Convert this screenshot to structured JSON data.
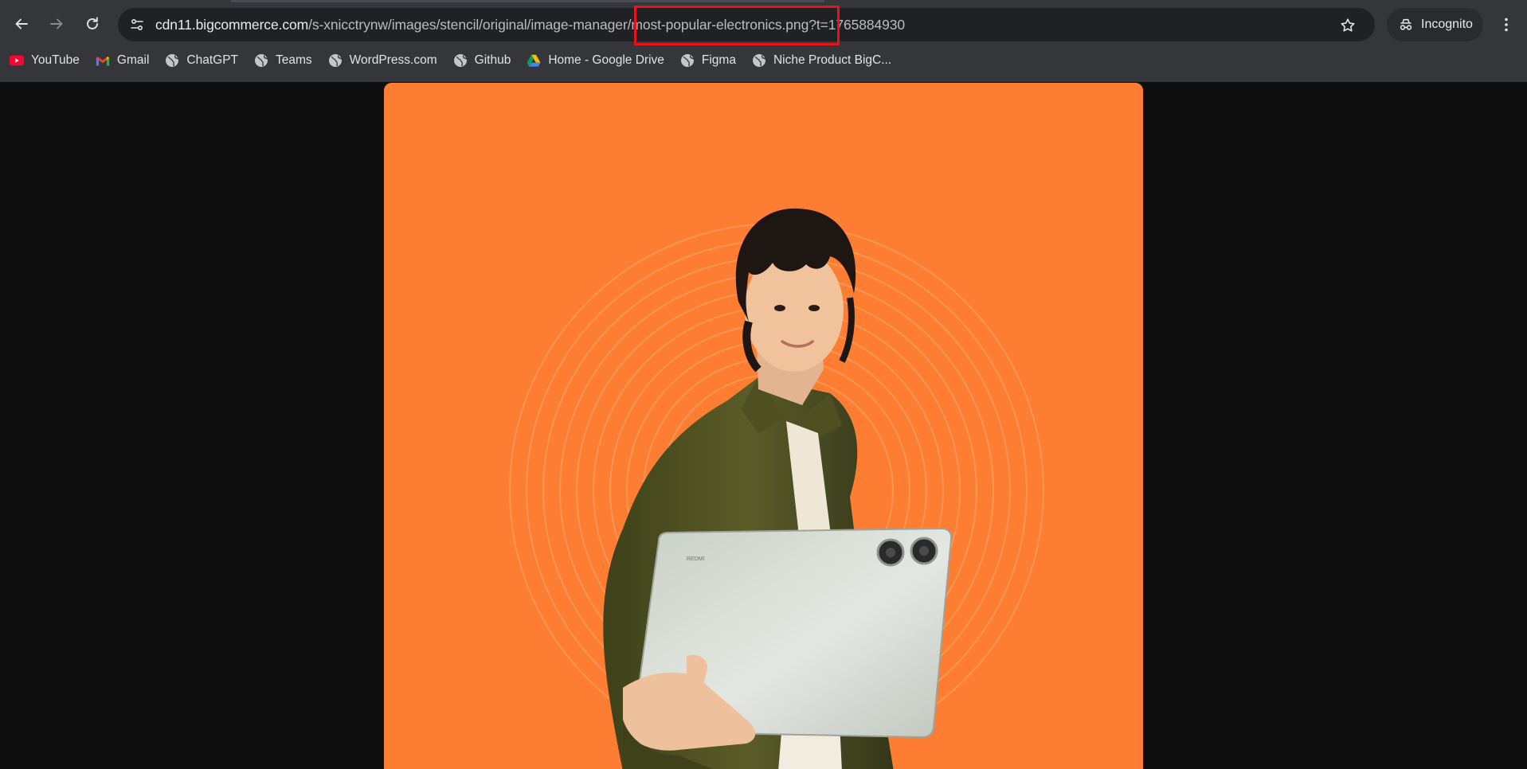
{
  "browser": {
    "url_host": "cdn11.bigcommerce.com",
    "url_path": "/s-xnicctrynw/images/stencil/original/image-manager/most-popular-electronics.png?t=1765884930",
    "incognito_label": "Incognito"
  },
  "bookmarks": [
    {
      "label": "YouTube",
      "icon": "youtube-icon"
    },
    {
      "label": "Gmail",
      "icon": "gmail-icon"
    },
    {
      "label": "ChatGPT",
      "icon": "globe-icon"
    },
    {
      "label": "Teams",
      "icon": "globe-icon"
    },
    {
      "label": "WordPress.com",
      "icon": "globe-icon"
    },
    {
      "label": "Github",
      "icon": "globe-icon"
    },
    {
      "label": "Home - Google Drive",
      "icon": "google-drive-icon"
    },
    {
      "label": "Figma",
      "icon": "globe-icon"
    },
    {
      "label": "Niche Product BigC...",
      "icon": "globe-icon"
    }
  ],
  "content": {
    "image_background": "#fd7e32",
    "tablet_brand": "REDMI"
  },
  "colors": {
    "toolbar": "#35363a",
    "omnibox": "#202124",
    "highlight": "#e8121b",
    "page_background": "#0e0e0e"
  }
}
